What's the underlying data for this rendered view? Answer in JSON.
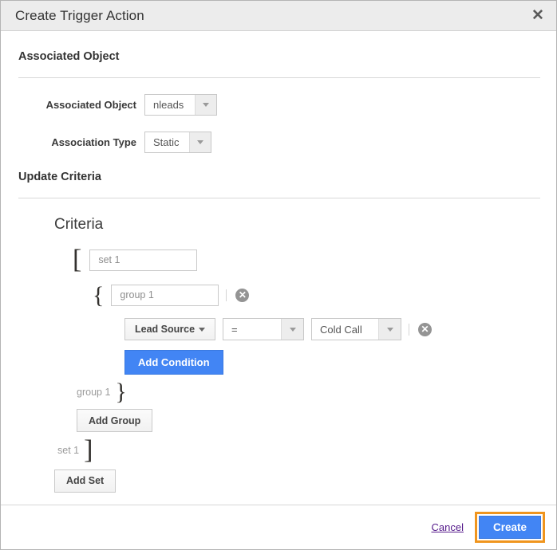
{
  "dialog": {
    "title": "Create Trigger Action",
    "close_icon": "close-icon",
    "close_glyph": "✕"
  },
  "sections": {
    "associated_object": {
      "heading": "Associated Object",
      "fields": [
        {
          "label": "Associated Object",
          "value": "nleads"
        },
        {
          "label": "Association Type",
          "value": "Static"
        }
      ]
    },
    "update_criteria": {
      "heading": "Update Criteria",
      "criteria_title": "Criteria",
      "set": {
        "open_bracket": "[",
        "close_bracket": "]",
        "name_value": "set 1",
        "close_label": "set 1",
        "add_set_label": "Add Set"
      },
      "group": {
        "open_brace": "{",
        "close_brace": "}",
        "name_value": "group 1",
        "close_label": "group 1",
        "delete_icon_glyph": "✕",
        "add_group_label": "Add Group"
      },
      "condition": {
        "field_label": "Lead Source",
        "operator": "=",
        "value": "Cold Call",
        "delete_icon_glyph": "✕",
        "add_condition_label": "Add Condition"
      }
    }
  },
  "footer": {
    "cancel_label": "Cancel",
    "create_label": "Create"
  },
  "colors": {
    "accent_blue": "#4285f4",
    "focus_orange": "#f0951e",
    "link_purple": "#551a8b",
    "titlebar_bg": "#ececec",
    "delete_gray": "#949494"
  }
}
